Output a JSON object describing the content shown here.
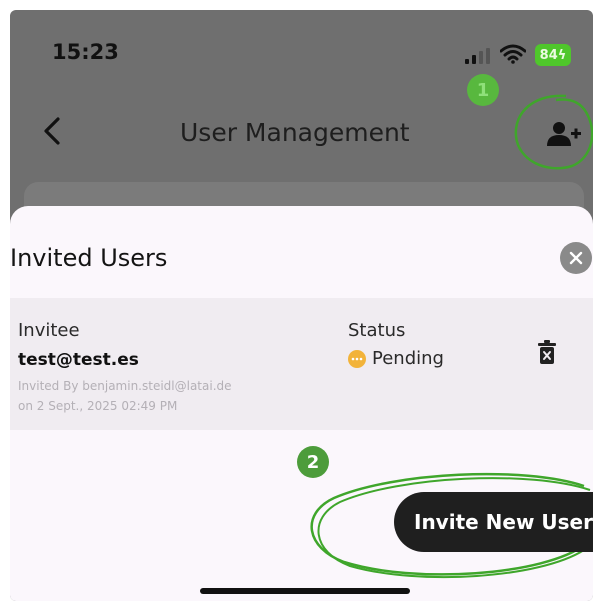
{
  "status_bar": {
    "time": "15:23",
    "battery": "84",
    "icons": [
      "signal-icon",
      "wifi-icon",
      "battery-charging-icon"
    ]
  },
  "header": {
    "title": "User Management",
    "back_icon": "chevron-left-icon",
    "add_user_icon": "person-add-icon"
  },
  "annotations": {
    "badge_1": "1",
    "badge_2": "2",
    "color": "#3fa62b"
  },
  "sheet": {
    "title": "Invited Users",
    "close_icon": "close-icon",
    "columns": {
      "invitee": "Invitee",
      "status": "Status"
    },
    "invites": [
      {
        "email": "test@test.es",
        "invited_by": "Invited By benjamin.steidl@latai.de",
        "invited_on": "on 2 Sept., 2025 02:49 PM",
        "status": "Pending",
        "status_color": "#f2b33a"
      }
    ],
    "invite_button": "Invite New User"
  },
  "colors": {
    "overlay": "#6f6f6f",
    "sheet": "#fbf7fc",
    "row": "#f0ecf1",
    "button": "#1f1f1f",
    "battery": "#4fc72b"
  }
}
